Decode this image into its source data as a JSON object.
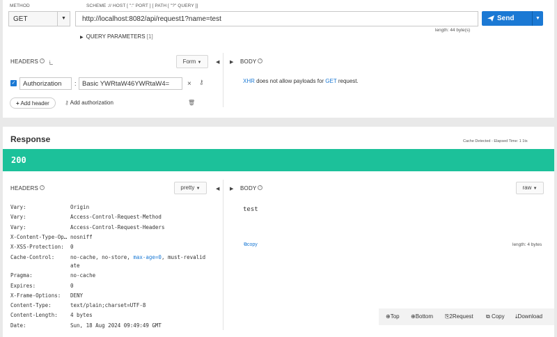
{
  "request": {
    "method_label": "METHOD",
    "method_value": "GET",
    "url_label": "SCHEME :// HOST [ \":\" PORT ] [ PATH [ \"?\" QUERY ]]",
    "url_value": "http://localhost:8082/api/request1?name=test",
    "send_label": "Send",
    "length_info": "length: 44 byte(s)",
    "query_params_label": "QUERY PARAMETERS",
    "query_params_count": "[1]",
    "headers_title": "HEADERS",
    "headers_mode": "Form",
    "header_rows": [
      {
        "enabled": true,
        "name": "Authorization",
        "value": "Basic YWRtaW46YWRtaW4="
      }
    ],
    "add_header_label": "Add header",
    "add_auth_label": "Add authorization",
    "body_title": "BODY",
    "body_msg_prefix": "XHR",
    "body_msg_middle": " does not allow payloads for ",
    "body_msg_method": "GET",
    "body_msg_suffix": " request."
  },
  "response": {
    "title": "Response",
    "cache_info": "Cache Detected - Elapsed Time: 1 1ts",
    "status_code": "200",
    "headers_title": "HEADERS",
    "headers_mode": "pretty",
    "body_title": "BODY",
    "body_mode": "raw",
    "body_text": "test",
    "copy_label": "copy",
    "length_info": "length: 4 bytes",
    "headers": [
      {
        "name": "Vary:",
        "value": "Origin"
      },
      {
        "name": "Vary:",
        "value": "Access-Control-Request-Method"
      },
      {
        "name": "Vary:",
        "value": "Access-Control-Request-Headers"
      },
      {
        "name": "X-Content-Type-Op…",
        "value": "nosniff"
      },
      {
        "name": "X-XSS-Protection:",
        "value": "0"
      },
      {
        "name": "Cache-Control:",
        "value_a": "no-cache, no-store, ",
        "value_kw": "max-age=0",
        "value_b": ", must-revalid",
        "value_c": "ate"
      },
      {
        "name": "Pragma:",
        "value": "no-cache"
      },
      {
        "name": "Expires:",
        "value": "0"
      },
      {
        "name": "X-Frame-Options:",
        "value": "DENY"
      },
      {
        "name": "Content-Type:",
        "value": "text/plain;charset=UTF-8"
      },
      {
        "name": "Content-Length:",
        "value": "4 bytes"
      },
      {
        "name": "Date:",
        "value": "Sun, 18 Aug 2024 09:49:49 GMT"
      }
    ],
    "bottom_actions": {
      "top": "Top",
      "bottom": "Bottom",
      "to_request": "2Request",
      "copy": "Copy",
      "download": "Download"
    }
  },
  "colors": {
    "accent": "#1b79d4",
    "status_ok": "#1cc19a"
  }
}
